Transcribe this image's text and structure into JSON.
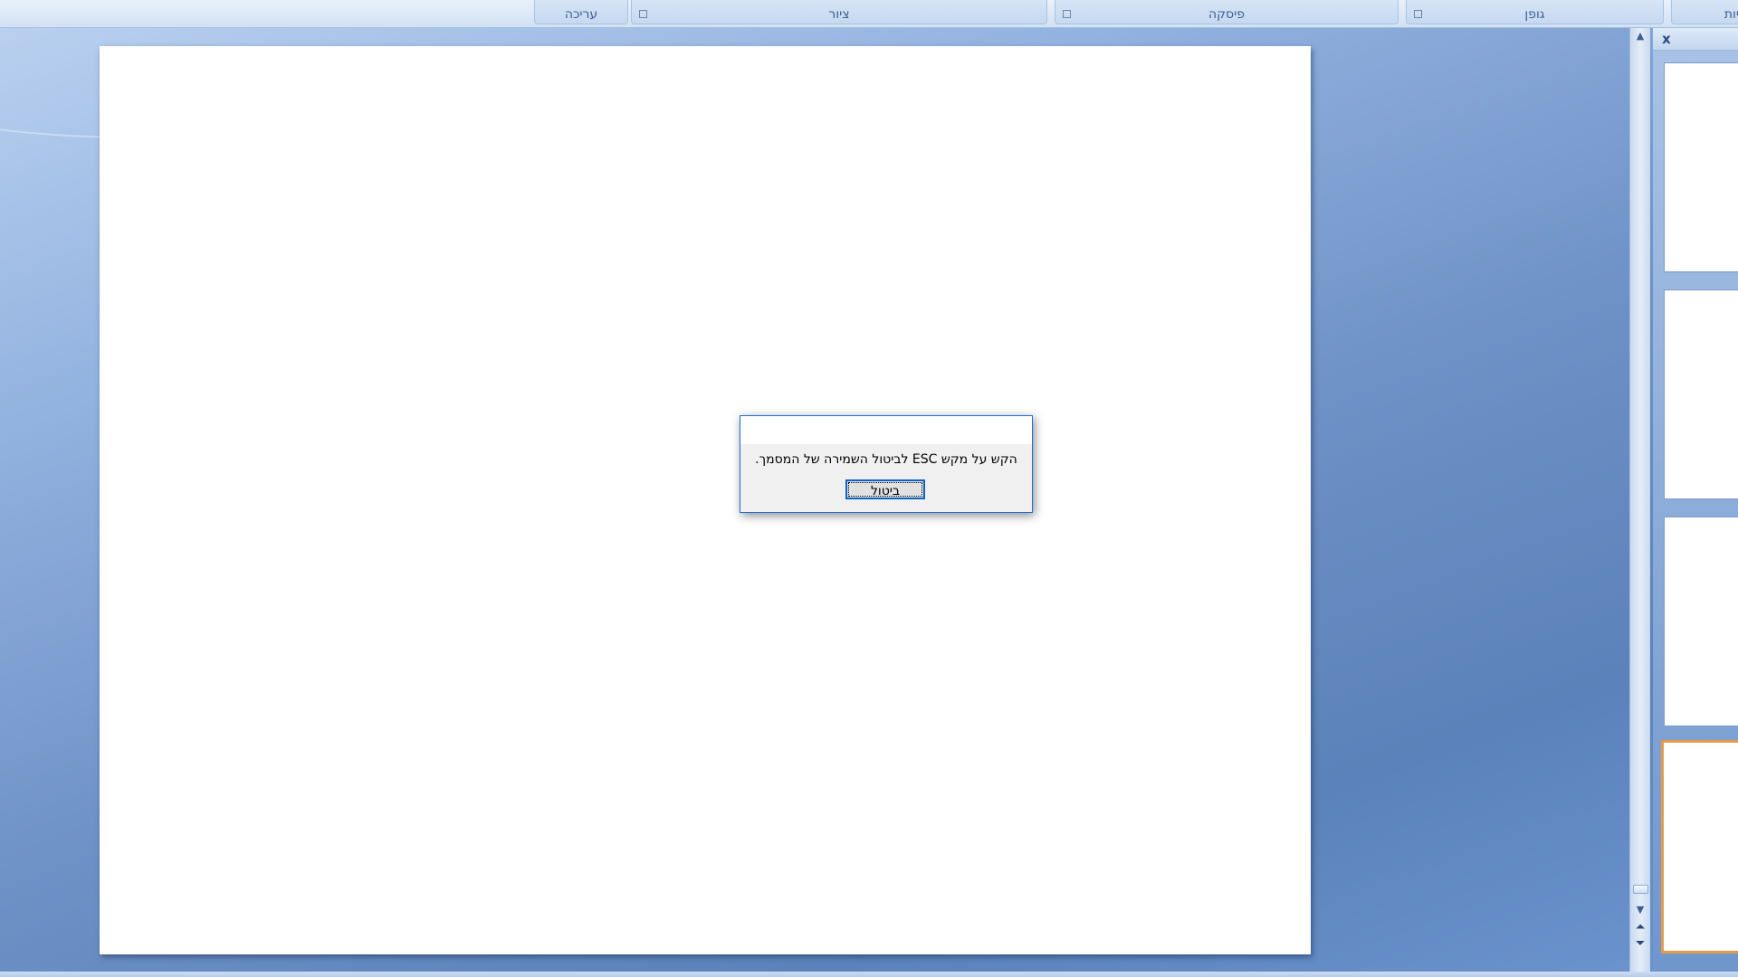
{
  "ribbon": {
    "groups": [
      {
        "label": "עריכה",
        "has_launcher": false
      },
      {
        "label": "ציור",
        "has_launcher": true
      },
      {
        "label": "פיסקה",
        "has_launcher": true
      },
      {
        "label": "גופן",
        "has_launcher": true
      },
      {
        "label": "יות",
        "has_launcher": false
      }
    ]
  },
  "slide_pane": {
    "close_label": "x",
    "thumbnail_count": 4,
    "selected_index": 3
  },
  "dialog": {
    "message": "הקש על מקש ESC לביטול השמירה של המסמך.",
    "cancel_label": "ביטול"
  },
  "colors": {
    "dialog_border": "#1e6fd0",
    "selected_thumbnail_border": "#e39b4b"
  }
}
